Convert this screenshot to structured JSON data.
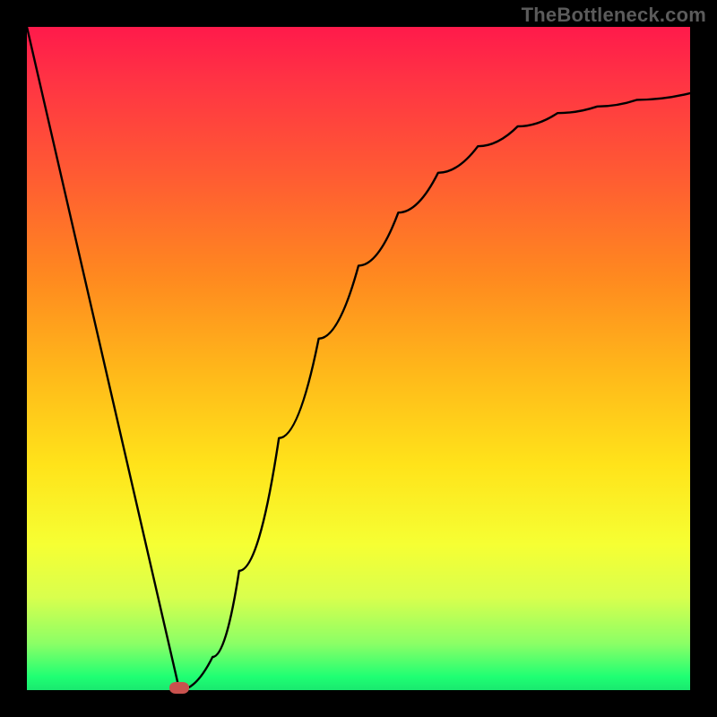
{
  "watermark": "TheBottleneck.com",
  "chart_data": {
    "type": "line",
    "title": "",
    "xlabel": "",
    "ylabel": "",
    "xlim": [
      0,
      1
    ],
    "ylim": [
      0,
      1
    ],
    "grid": false,
    "legend": false,
    "series": [
      {
        "name": "curve",
        "x": [
          0.0,
          0.23,
          0.28,
          0.32,
          0.38,
          0.44,
          0.5,
          0.56,
          0.62,
          0.68,
          0.74,
          0.8,
          0.86,
          0.92,
          1.0
        ],
        "y": [
          1.0,
          0.0,
          0.05,
          0.18,
          0.38,
          0.53,
          0.64,
          0.72,
          0.78,
          0.82,
          0.85,
          0.87,
          0.88,
          0.89,
          0.9
        ]
      }
    ],
    "annotations": [
      {
        "name": "min-marker",
        "x": 0.23,
        "y": 0.0
      }
    ],
    "background_gradient": {
      "direction": "top-to-bottom",
      "stops": [
        {
          "pos": 0.0,
          "color": "#ff1a4b"
        },
        {
          "pos": 0.5,
          "color": "#ffb81a"
        },
        {
          "pos": 0.8,
          "color": "#f6ff33"
        },
        {
          "pos": 1.0,
          "color": "#19e86f"
        }
      ]
    }
  }
}
